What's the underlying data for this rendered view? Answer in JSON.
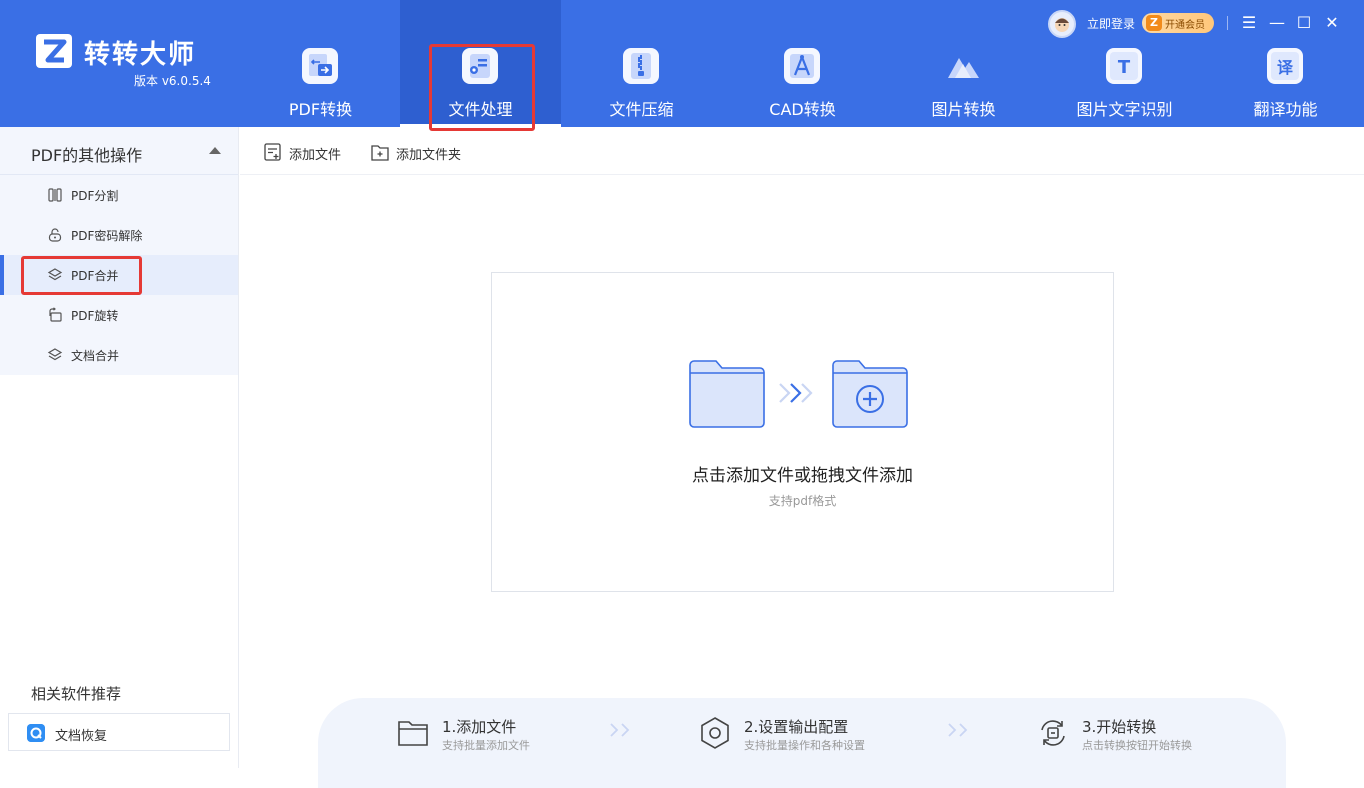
{
  "app": {
    "name": "转转大师",
    "version": "版本 v6.0.5.4"
  },
  "account": {
    "login_label": "立即登录",
    "vip_label": "开通会员",
    "vip_mark": "Z"
  },
  "window_controls": {
    "menu": "☰",
    "minimize": "—",
    "maximize": "☐",
    "close": "✕"
  },
  "nav": {
    "active": "文件处理",
    "items": [
      {
        "label": "PDF转换",
        "icon": "pdf-convert-icon"
      },
      {
        "label": "文件处理",
        "icon": "file-process-icon"
      },
      {
        "label": "文件压缩",
        "icon": "zip-icon"
      },
      {
        "label": "CAD转换",
        "icon": "cad-icon"
      },
      {
        "label": "图片转换",
        "icon": "image-mountain-icon"
      },
      {
        "label": "图片文字识别",
        "icon": "ocr-t-icon"
      },
      {
        "label": "翻译功能",
        "icon": "translate-icon"
      }
    ],
    "ocr_glyph": "T",
    "translate_glyph": "译"
  },
  "sidebar": {
    "section_title": "PDF的其他操作",
    "items": [
      {
        "label": "PDF分割",
        "icon": "split-icon"
      },
      {
        "label": "PDF密码解除",
        "icon": "unlock-icon"
      },
      {
        "label": "PDF合并",
        "icon": "layers-icon"
      },
      {
        "label": "PDF旋转",
        "icon": "rotate-icon"
      },
      {
        "label": "文档合并",
        "icon": "layers-icon"
      }
    ],
    "active_item": "PDF合并",
    "recommend_title": "相关软件推荐",
    "recommend_items": [
      {
        "label": "文档恢复",
        "icon": "recovery-app-icon"
      }
    ]
  },
  "toolbar": {
    "add_file": "添加文件",
    "add_folder": "添加文件夹"
  },
  "dropzone": {
    "title": "点击添加文件或拖拽文件添加",
    "subtitle": "支持pdf格式"
  },
  "steps": [
    {
      "title": "1.添加文件",
      "desc": "支持批量添加文件",
      "icon": "folder-icon"
    },
    {
      "title": "2.设置输出配置",
      "desc": "支持批量操作和各种设置",
      "icon": "settings-icon"
    },
    {
      "title": "3.开始转换",
      "desc": "点击转换按钮开始转换",
      "icon": "convert-icon"
    }
  ],
  "colors": {
    "header_bg": "#3a6fe5",
    "header_active_bg": "#2e5fd0",
    "highlight_red": "#e53935",
    "sidebar_bg": "#f3f6fd",
    "accent": "#3a6fe5"
  }
}
